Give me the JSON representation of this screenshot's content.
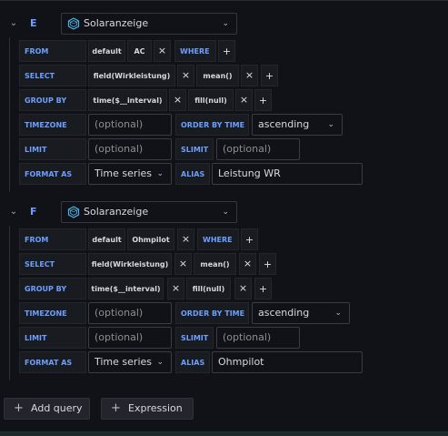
{
  "queries": [
    {
      "ref_id": "E",
      "datasource": "Solaranzeige",
      "from": {
        "label": "FROM",
        "policy": "default",
        "measurement": "AC",
        "where_label": "WHERE"
      },
      "select": {
        "label": "SELECT",
        "field": "field(Wirkleistung)",
        "agg": "mean()"
      },
      "group_by": {
        "label": "GROUP BY",
        "time": "time($__interval)",
        "fill": "fill(null)"
      },
      "timezone": {
        "label": "TIMEZONE",
        "placeholder": "(optional)",
        "order_label": "ORDER BY TIME",
        "order_value": "ascending"
      },
      "limit": {
        "label": "LIMIT",
        "placeholder": "(optional)",
        "slimit_label": "SLIMIT",
        "slimit_placeholder": "(optional)"
      },
      "format": {
        "label": "FORMAT AS",
        "value": "Time series",
        "alias_label": "ALIAS",
        "alias_value": "Leistung WR"
      }
    },
    {
      "ref_id": "F",
      "datasource": "Solaranzeige",
      "from": {
        "label": "FROM",
        "policy": "default",
        "measurement": "Ohmpilot",
        "where_label": "WHERE"
      },
      "select": {
        "label": "SELECT",
        "field": "field(Wirkleistung)",
        "agg": "mean()"
      },
      "group_by": {
        "label": "GROUP BY",
        "time": "time($__interval)",
        "fill": "fill(null)"
      },
      "timezone": {
        "label": "TIMEZONE",
        "placeholder": "(optional)",
        "order_label": "ORDER BY TIME",
        "order_value": "ascending"
      },
      "limit": {
        "label": "LIMIT",
        "placeholder": "(optional)",
        "slimit_label": "SLIMIT",
        "slimit_placeholder": "(optional)"
      },
      "format": {
        "label": "FORMAT AS",
        "value": "Time series",
        "alias_label": "ALIAS",
        "alias_value": "Ohmpilot"
      }
    }
  ],
  "symbols": {
    "remove": "×",
    "add": "+",
    "caret": "⌄",
    "collapse": "⌄"
  },
  "buttons": {
    "add_query": "Add query",
    "expression": "Expression"
  },
  "colors": {
    "accent": "#6e9fff",
    "background": "#111217",
    "segment": "#181b1f"
  },
  "icons": {
    "datasource": "influxdb-logo-icon"
  }
}
